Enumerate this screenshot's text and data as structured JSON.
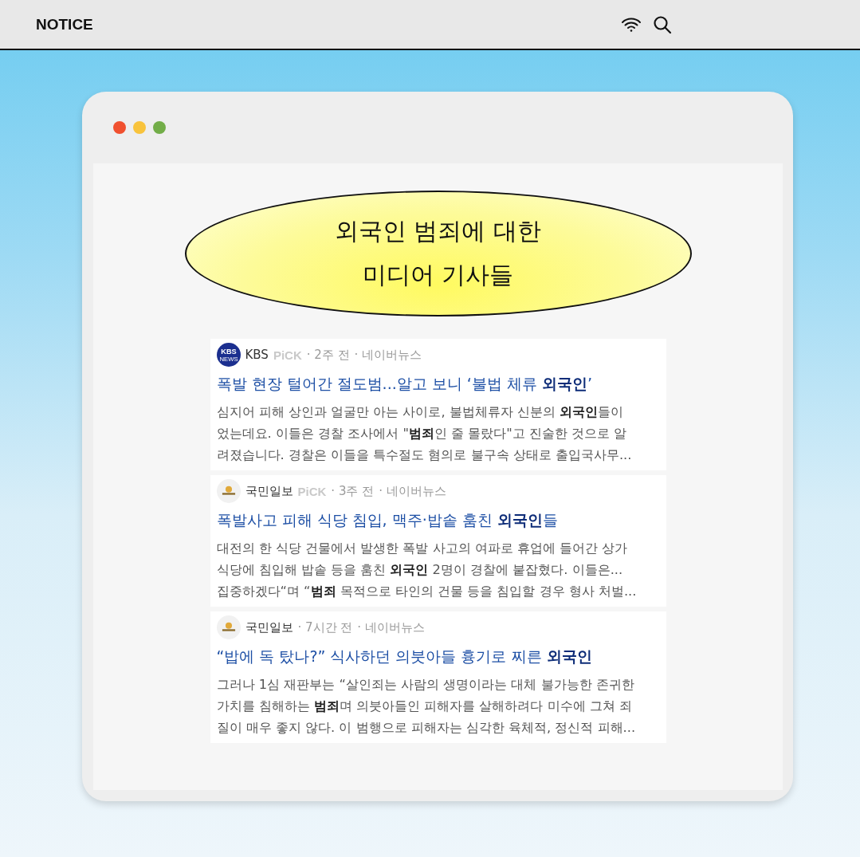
{
  "top_bar": {
    "title": "NOTICE"
  },
  "window": {
    "dots": [
      {
        "color": "#f0502f"
      },
      {
        "color": "#f8c33c"
      },
      {
        "color": "#72ad48"
      }
    ],
    "banner": {
      "lines": [
        "외국인 범죄에 대한",
        "미디어 기사들"
      ]
    },
    "articles": [
      {
        "logo": {
          "kind": "kbs",
          "text": "KBS NEWS"
        },
        "source": "KBS",
        "badge": "PiCK",
        "time": "· 2주 전",
        "platform": "· 네이버뉴스",
        "headline": "폭발 현장 털어간 절도범...알고 보니 ‘불법 체류 **외국인**’",
        "snippet": [
          "심지어 피해 상인과 얼굴만 아는 사이로, 불법체류자 신분의 **외국인**들이",
          "었는데요. 이들은 경찰 조사에서 \"**범죄**인 줄 몰랐다\"고 진술한 것으로 알",
          "려졌습니다. 경찰은 이들을 특수절도 혐의로 불구속 상태로 출입국사무..."
        ]
      },
      {
        "logo": {
          "kind": "emblem"
        },
        "source": "국민일보",
        "badge": "PiCK",
        "time": "· 3주 전",
        "platform": "· 네이버뉴스",
        "headline": "폭발사고 피해 식당 침입, 맥주·밥솥 훔친 **외국인**들",
        "snippet": [
          "대전의 한 식당 건물에서 발생한 폭발 사고의 여파로 휴업에 들어간 상가",
          "식당에 침입해 밥솥 등을 훔친 **외국인** 2명이 경찰에 붙잡혔다. 이들은...",
          "집중하겠다“며 “**범죄** 목적으로 타인의 건물 등을 침입할 경우 형사 처벌..."
        ]
      },
      {
        "logo": {
          "kind": "emblem"
        },
        "source": "국민일보",
        "time": "· 7시간 전",
        "platform": "· 네이버뉴스",
        "headline": "“밥에 독 탔나?” 식사하던 의붓아들 흉기로 찌른 **외국인**",
        "snippet": [
          "그러나 1심 재판부는 “살인죄는 사람의 생명이라는 대체 불가능한 존귀한",
          "가치를 침해하는 **범죄**며 의붓아들인 피해자를 살해하려다 미수에 그쳐 죄",
          "질이 매우 좋지 않다. 이 범행으로 피해자는 심각한 육체적, 정신적 피해..."
        ]
      }
    ]
  }
}
